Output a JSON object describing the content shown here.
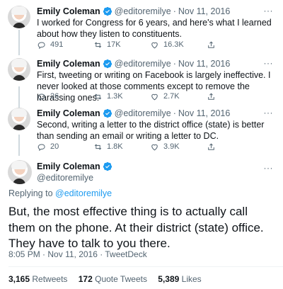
{
  "thread": [
    {
      "name": "Emily Coleman",
      "handle": "@editoremilye",
      "date": "Nov 11, 2016",
      "text": "I worked for Congress for 6 years, and here's what I learned about how they listen to constituents.",
      "replies": "491",
      "retweets": "17K",
      "likes": "16.3K"
    },
    {
      "name": "Emily Coleman",
      "handle": "@editoremilye",
      "date": "Nov 11, 2016",
      "text": "First, tweeting or writing on Facebook is largely ineffective. I never looked at those comments except to remove the harassing ones.",
      "replies": "26",
      "retweets": "1.3K",
      "likes": "2.7K"
    },
    {
      "name": "Emily Coleman",
      "handle": "@editoremilye",
      "date": "Nov 11, 2016",
      "text": "Second, writing a letter to the district office (state) is better than sending an email or writing a letter to DC.",
      "replies": "20",
      "retweets": "1.8K",
      "likes": "3.9K"
    }
  ],
  "separator": "·",
  "more": "···",
  "main": {
    "name": "Emily Coleman",
    "handle": "@editoremilye",
    "replying_prefix": "Replying to",
    "replying_to": "@editoremilye",
    "text": "But, the most effective thing is to actually call them on the phone. At their district (state) office. They have to talk to you there.",
    "time": "8:05 PM",
    "date": "Nov 11, 2016",
    "source": "TweetDeck",
    "retweets_count": "3,165",
    "retweets_label": "Retweets",
    "quotes_count": "172",
    "quotes_label": "Quote Tweets",
    "likes_count": "5,389",
    "likes_label": "Likes"
  },
  "colors": {
    "verified": "#1d9bf0",
    "muted": "#536471",
    "link": "#1d9bf0"
  },
  "icons": [
    "verified-badge-icon",
    "reply-icon",
    "retweet-icon",
    "like-icon",
    "share-icon",
    "more-icon"
  ]
}
